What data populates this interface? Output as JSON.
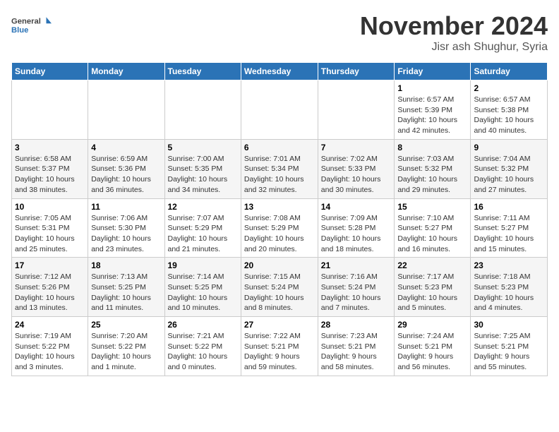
{
  "logo": {
    "line1": "General",
    "line2": "Blue"
  },
  "title": "November 2024",
  "location": "Jisr ash Shughur, Syria",
  "weekdays": [
    "Sunday",
    "Monday",
    "Tuesday",
    "Wednesday",
    "Thursday",
    "Friday",
    "Saturday"
  ],
  "weeks": [
    [
      {
        "day": "",
        "info": ""
      },
      {
        "day": "",
        "info": ""
      },
      {
        "day": "",
        "info": ""
      },
      {
        "day": "",
        "info": ""
      },
      {
        "day": "",
        "info": ""
      },
      {
        "day": "1",
        "info": "Sunrise: 6:57 AM\nSunset: 5:39 PM\nDaylight: 10 hours\nand 42 minutes."
      },
      {
        "day": "2",
        "info": "Sunrise: 6:57 AM\nSunset: 5:38 PM\nDaylight: 10 hours\nand 40 minutes."
      }
    ],
    [
      {
        "day": "3",
        "info": "Sunrise: 6:58 AM\nSunset: 5:37 PM\nDaylight: 10 hours\nand 38 minutes."
      },
      {
        "day": "4",
        "info": "Sunrise: 6:59 AM\nSunset: 5:36 PM\nDaylight: 10 hours\nand 36 minutes."
      },
      {
        "day": "5",
        "info": "Sunrise: 7:00 AM\nSunset: 5:35 PM\nDaylight: 10 hours\nand 34 minutes."
      },
      {
        "day": "6",
        "info": "Sunrise: 7:01 AM\nSunset: 5:34 PM\nDaylight: 10 hours\nand 32 minutes."
      },
      {
        "day": "7",
        "info": "Sunrise: 7:02 AM\nSunset: 5:33 PM\nDaylight: 10 hours\nand 30 minutes."
      },
      {
        "day": "8",
        "info": "Sunrise: 7:03 AM\nSunset: 5:32 PM\nDaylight: 10 hours\nand 29 minutes."
      },
      {
        "day": "9",
        "info": "Sunrise: 7:04 AM\nSunset: 5:32 PM\nDaylight: 10 hours\nand 27 minutes."
      }
    ],
    [
      {
        "day": "10",
        "info": "Sunrise: 7:05 AM\nSunset: 5:31 PM\nDaylight: 10 hours\nand 25 minutes."
      },
      {
        "day": "11",
        "info": "Sunrise: 7:06 AM\nSunset: 5:30 PM\nDaylight: 10 hours\nand 23 minutes."
      },
      {
        "day": "12",
        "info": "Sunrise: 7:07 AM\nSunset: 5:29 PM\nDaylight: 10 hours\nand 21 minutes."
      },
      {
        "day": "13",
        "info": "Sunrise: 7:08 AM\nSunset: 5:29 PM\nDaylight: 10 hours\nand 20 minutes."
      },
      {
        "day": "14",
        "info": "Sunrise: 7:09 AM\nSunset: 5:28 PM\nDaylight: 10 hours\nand 18 minutes."
      },
      {
        "day": "15",
        "info": "Sunrise: 7:10 AM\nSunset: 5:27 PM\nDaylight: 10 hours\nand 16 minutes."
      },
      {
        "day": "16",
        "info": "Sunrise: 7:11 AM\nSunset: 5:27 PM\nDaylight: 10 hours\nand 15 minutes."
      }
    ],
    [
      {
        "day": "17",
        "info": "Sunrise: 7:12 AM\nSunset: 5:26 PM\nDaylight: 10 hours\nand 13 minutes."
      },
      {
        "day": "18",
        "info": "Sunrise: 7:13 AM\nSunset: 5:25 PM\nDaylight: 10 hours\nand 11 minutes."
      },
      {
        "day": "19",
        "info": "Sunrise: 7:14 AM\nSunset: 5:25 PM\nDaylight: 10 hours\nand 10 minutes."
      },
      {
        "day": "20",
        "info": "Sunrise: 7:15 AM\nSunset: 5:24 PM\nDaylight: 10 hours\nand 8 minutes."
      },
      {
        "day": "21",
        "info": "Sunrise: 7:16 AM\nSunset: 5:24 PM\nDaylight: 10 hours\nand 7 minutes."
      },
      {
        "day": "22",
        "info": "Sunrise: 7:17 AM\nSunset: 5:23 PM\nDaylight: 10 hours\nand 5 minutes."
      },
      {
        "day": "23",
        "info": "Sunrise: 7:18 AM\nSunset: 5:23 PM\nDaylight: 10 hours\nand 4 minutes."
      }
    ],
    [
      {
        "day": "24",
        "info": "Sunrise: 7:19 AM\nSunset: 5:22 PM\nDaylight: 10 hours\nand 3 minutes."
      },
      {
        "day": "25",
        "info": "Sunrise: 7:20 AM\nSunset: 5:22 PM\nDaylight: 10 hours\nand 1 minute."
      },
      {
        "day": "26",
        "info": "Sunrise: 7:21 AM\nSunset: 5:22 PM\nDaylight: 10 hours\nand 0 minutes."
      },
      {
        "day": "27",
        "info": "Sunrise: 7:22 AM\nSunset: 5:21 PM\nDaylight: 9 hours\nand 59 minutes."
      },
      {
        "day": "28",
        "info": "Sunrise: 7:23 AM\nSunset: 5:21 PM\nDaylight: 9 hours\nand 58 minutes."
      },
      {
        "day": "29",
        "info": "Sunrise: 7:24 AM\nSunset: 5:21 PM\nDaylight: 9 hours\nand 56 minutes."
      },
      {
        "day": "30",
        "info": "Sunrise: 7:25 AM\nSunset: 5:21 PM\nDaylight: 9 hours\nand 55 minutes."
      }
    ]
  ]
}
